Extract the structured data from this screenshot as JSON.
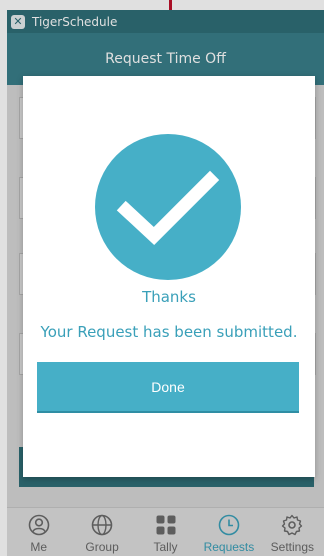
{
  "app": {
    "name": "TigerSchedule"
  },
  "header": {
    "title": "Request Time Off"
  },
  "dialog": {
    "thanks": "Thanks",
    "message": "Your Request has been submitted.",
    "done_label": "Done"
  },
  "tabs": [
    {
      "label": "Me",
      "icon": "person-icon"
    },
    {
      "label": "Group",
      "icon": "globe-icon"
    },
    {
      "label": "Tally",
      "icon": "grid-icon"
    },
    {
      "label": "Requests",
      "icon": "clock-icon",
      "active": true
    },
    {
      "label": "Settings",
      "icon": "gear-icon"
    }
  ],
  "colors": {
    "accent": "#46afc7",
    "header": "#3a7f8a",
    "titlebar": "#2f6f78",
    "text_accent": "#3aa0b9",
    "marker": "#c0102b"
  }
}
